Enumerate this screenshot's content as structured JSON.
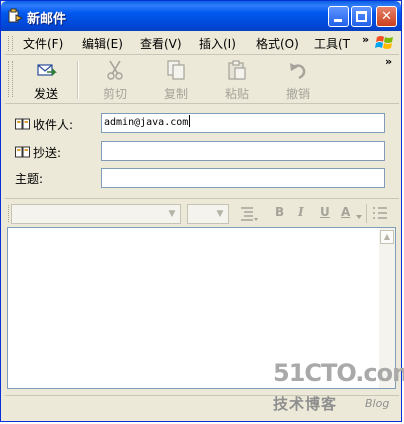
{
  "window": {
    "title": "新邮件"
  },
  "menubar": {
    "items": [
      "文件(F)",
      "编辑(E)",
      "查看(V)",
      "插入(I)",
      "格式(O)",
      "工具(T"
    ],
    "overflow": "»"
  },
  "toolbar": {
    "buttons": [
      {
        "label": "发送",
        "icon": "send-icon",
        "enabled": true
      },
      {
        "label": "剪切",
        "icon": "scissors-icon",
        "enabled": false
      },
      {
        "label": "复制",
        "icon": "copy-icon",
        "enabled": false
      },
      {
        "label": "粘贴",
        "icon": "clipboard-icon",
        "enabled": false
      },
      {
        "label": "撤销",
        "icon": "undo-icon",
        "enabled": false
      }
    ],
    "overflow": "»"
  },
  "header": {
    "to_label": "收件人:",
    "to_value": "admin@java.com",
    "cc_label": "抄送:",
    "cc_value": "",
    "subject_label": "主题:",
    "subject_value": ""
  },
  "format": {
    "font": "",
    "size": "",
    "bold": "B",
    "italic": "I",
    "underline": "U",
    "font_color": "A"
  },
  "watermark": {
    "brand": "51CTO.com",
    "tagline": "技术博客",
    "blog": "Blog"
  },
  "colors": {
    "titlebar": "#0058ee",
    "chrome": "#ece9d8",
    "field_border": "#7f9db9"
  }
}
